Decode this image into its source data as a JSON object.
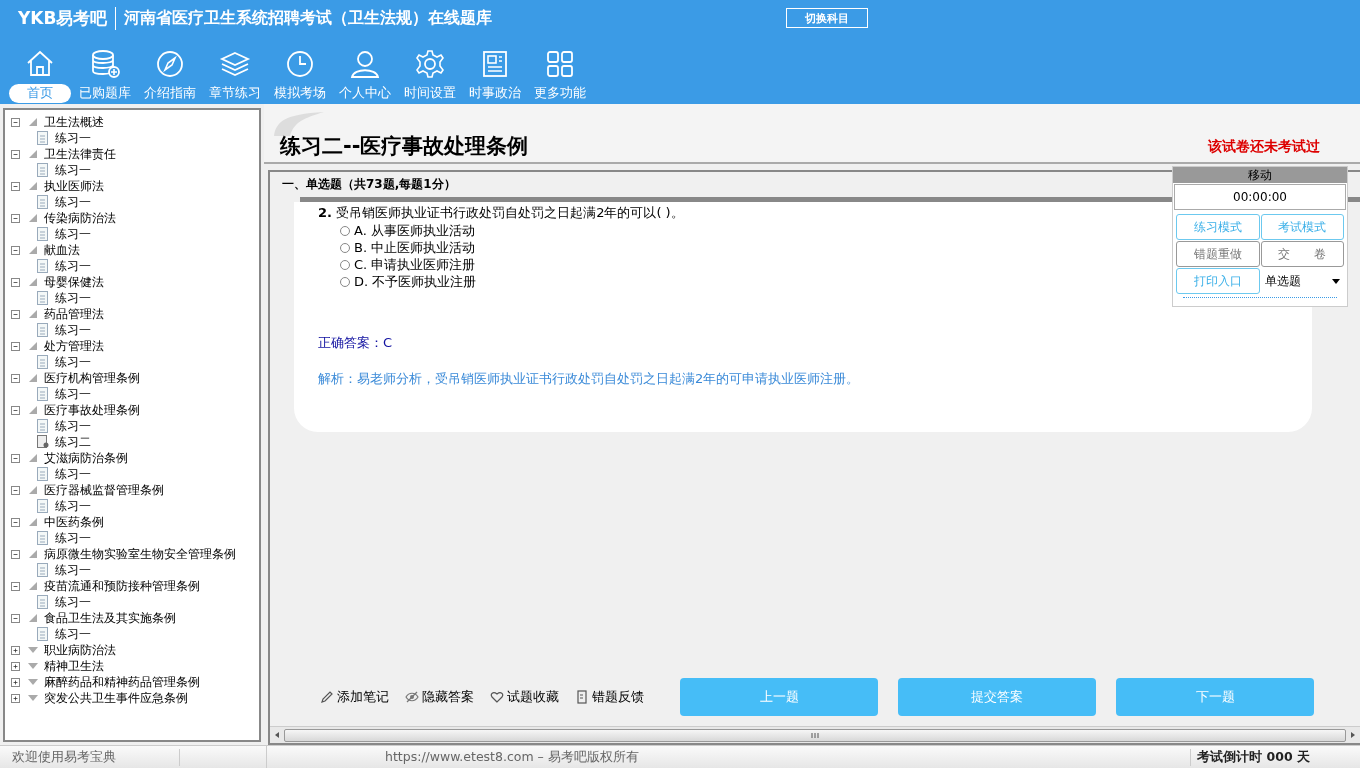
{
  "header": {
    "logo": "YKB易考吧",
    "title": "河南省医疗卫生系统招聘考试（卫生法规）在线题库",
    "switch_button": "切换科目"
  },
  "nav": [
    {
      "label": "首页",
      "selected": true
    },
    {
      "label": "已购题库",
      "selected": false
    },
    {
      "label": "介绍指南",
      "selected": false
    },
    {
      "label": "章节练习",
      "selected": false
    },
    {
      "label": "模拟考场",
      "selected": false
    },
    {
      "label": "个人中心",
      "selected": false
    },
    {
      "label": "时间设置",
      "selected": false
    },
    {
      "label": "时事政治",
      "selected": false
    },
    {
      "label": "更多功能",
      "selected": false
    }
  ],
  "tree": [
    {
      "label": "卫生法概述",
      "expanded": true,
      "children": [
        {
          "label": "练习一",
          "kind": "doc"
        }
      ]
    },
    {
      "label": "卫生法律责任",
      "expanded": true,
      "children": [
        {
          "label": "练习一",
          "kind": "doc"
        }
      ]
    },
    {
      "label": "执业医师法",
      "expanded": true,
      "children": [
        {
          "label": "练习一",
          "kind": "doc"
        }
      ]
    },
    {
      "label": "传染病防治法",
      "expanded": true,
      "children": [
        {
          "label": "练习一",
          "kind": "doc"
        }
      ]
    },
    {
      "label": "献血法",
      "expanded": true,
      "children": [
        {
          "label": "练习一",
          "kind": "doc"
        }
      ]
    },
    {
      "label": "母婴保健法",
      "expanded": true,
      "children": [
        {
          "label": "练习一",
          "kind": "doc"
        }
      ]
    },
    {
      "label": "药品管理法",
      "expanded": true,
      "children": [
        {
          "label": "练习一",
          "kind": "doc"
        }
      ]
    },
    {
      "label": "处方管理法",
      "expanded": true,
      "children": [
        {
          "label": "练习一",
          "kind": "doc"
        }
      ]
    },
    {
      "label": "医疗机构管理条例",
      "expanded": true,
      "children": [
        {
          "label": "练习一",
          "kind": "doc"
        }
      ]
    },
    {
      "label": "医疗事故处理条例",
      "expanded": true,
      "children": [
        {
          "label": "练习一",
          "kind": "doc"
        },
        {
          "label": "练习二",
          "kind": "current"
        }
      ]
    },
    {
      "label": "艾滋病防治条例",
      "expanded": true,
      "children": [
        {
          "label": "练习一",
          "kind": "doc"
        }
      ]
    },
    {
      "label": "医疗器械监督管理条例",
      "expanded": true,
      "children": [
        {
          "label": "练习一",
          "kind": "doc"
        }
      ]
    },
    {
      "label": "中医药条例",
      "expanded": true,
      "children": [
        {
          "label": "练习一",
          "kind": "doc"
        }
      ]
    },
    {
      "label": "病原微生物实验室生物安全管理条例",
      "expanded": true,
      "children": [
        {
          "label": "练习一",
          "kind": "doc"
        }
      ]
    },
    {
      "label": "疫苗流通和预防接种管理条例",
      "expanded": true,
      "children": [
        {
          "label": "练习一",
          "kind": "doc"
        }
      ]
    },
    {
      "label": "食品卫生法及其实施条例",
      "expanded": true,
      "children": [
        {
          "label": "练习一",
          "kind": "doc"
        }
      ]
    },
    {
      "label": "职业病防治法",
      "expanded": false
    },
    {
      "label": "精神卫生法",
      "expanded": false
    },
    {
      "label": "麻醉药品和精神药品管理条例",
      "expanded": false
    },
    {
      "label": "突发公共卫生事件应急条例",
      "expanded": false
    }
  ],
  "exercise": {
    "title": "练习二--医疗事故处理条例",
    "status": "该试卷还未考试过",
    "section": "一、单选题（共73题,每题1分）",
    "question": {
      "number": "2.",
      "text": "受吊销医师执业证书行政处罚自处罚之日起满2年的可以(  )。",
      "options": [
        {
          "label": "A. 从事医师执业活动",
          "selected": false
        },
        {
          "label": "B. 中止医师执业活动",
          "selected": false
        },
        {
          "label": "C. 申请执业医师注册",
          "selected": false
        },
        {
          "label": "D. 不予医师执业注册",
          "selected": false
        }
      ],
      "answer_label": "正确答案：",
      "answer": "C",
      "analysis": "解析：易老师分析，受吊销医师执业证书行政处罚自处罚之日起满2年的可申请执业医师注册。"
    },
    "tools": [
      "添加笔记",
      "隐藏答案",
      "试题收藏",
      "错题反馈"
    ],
    "buttons": [
      "上一题",
      "提交答案",
      "下一题"
    ]
  },
  "panel": {
    "title": "移动",
    "timer": "00:00:00",
    "buttons": [
      {
        "label": "练习模式",
        "kind": "blue"
      },
      {
        "label": "考试模式",
        "kind": "blue"
      },
      {
        "label": "错题重做",
        "kind": "gray"
      },
      {
        "label": "交　　卷",
        "kind": "gray"
      },
      {
        "label": "打印入口",
        "kind": "blue"
      }
    ],
    "type_select": "单选题"
  },
  "status_bar": {
    "welcome": "欢迎使用易考宝典",
    "copyright": "https://www.etest8.com – 易考吧版权所有",
    "countdown": "考试倒计时 000 天"
  }
}
